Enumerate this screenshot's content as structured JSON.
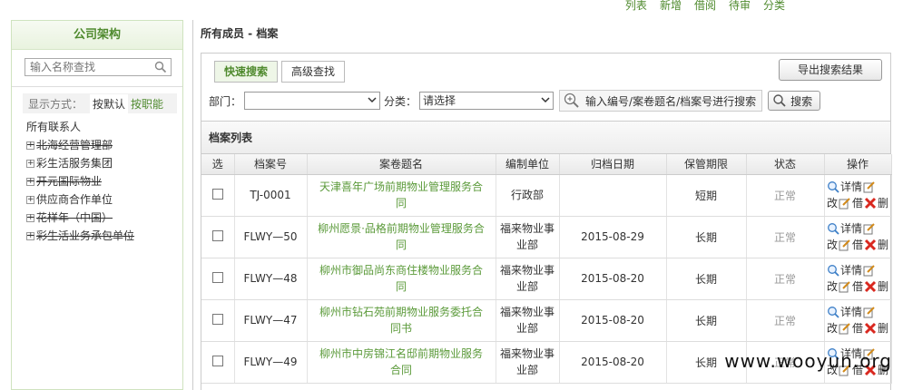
{
  "topnav": [
    "列表",
    "新增",
    "借阅",
    "待审",
    "分类"
  ],
  "left": {
    "title": "公司架构",
    "search_placeholder": "输入名称查找",
    "mode_label": "显示方式：",
    "mode_default": "按默认",
    "mode_role": "按职能",
    "root": "所有联系人",
    "nodes": [
      {
        "label": "北海经营管理部",
        "strike": true
      },
      {
        "label": "彩生活服务集团",
        "strike": false
      },
      {
        "label": "开元国际物业",
        "strike": true
      },
      {
        "label": "供应商合作单位",
        "strike": false
      },
      {
        "label": "花样年（中国）",
        "strike": true
      },
      {
        "label": "彩生活业务承包单位",
        "strike": true
      }
    ]
  },
  "main": {
    "title": "所有成员 - 档案",
    "tab_quick": "快速搜索",
    "tab_advanced": "高级查找",
    "export_label": "导出搜索结果",
    "dept_label": "部门：",
    "dept_value": "",
    "cat_label": "分类：",
    "cat_value": "请选择",
    "keyword_hint": "输入编号/案卷题名/档案号进行搜索",
    "search_label": "搜索",
    "grid_title": "档案列表",
    "columns": [
      "选",
      "档案号",
      "案卷题名",
      "编制单位",
      "归档日期",
      "保管期限",
      "状态",
      "操作"
    ],
    "ops": {
      "detail": "详情",
      "edit": "改",
      "letter": "借",
      "delete": "删"
    },
    "rows": [
      {
        "no": "TJ-0001",
        "title": "天津喜年广场前期物业管理服务合同",
        "unit": "行政部",
        "date": "",
        "period": "短期",
        "status": "正常"
      },
      {
        "no": "FLWY—50",
        "title": "柳州愿景·品格前期物业管理服务合同",
        "unit": "福来物业事业部",
        "date": "2015-08-29",
        "period": "长期",
        "status": "正常"
      },
      {
        "no": "FLWY—48",
        "title": "柳州市御品尚东商住楼物业服务合同",
        "unit": "福来物业事业部",
        "date": "2015-08-20",
        "period": "长期",
        "status": "正常"
      },
      {
        "no": "FLWY—47",
        "title": "柳州市钻石苑前期物业服务委托合同书",
        "unit": "福来物业事业部",
        "date": "2015-08-20",
        "period": "长期",
        "status": "正常"
      },
      {
        "no": "FLWY—49",
        "title": "柳州市中房锦江名邸前期物业服务合同",
        "unit": "福来物业事业部",
        "date": "2015-08-20",
        "period": "长期",
        "status": "正常"
      }
    ]
  },
  "watermark": "www.wooyun.org"
}
